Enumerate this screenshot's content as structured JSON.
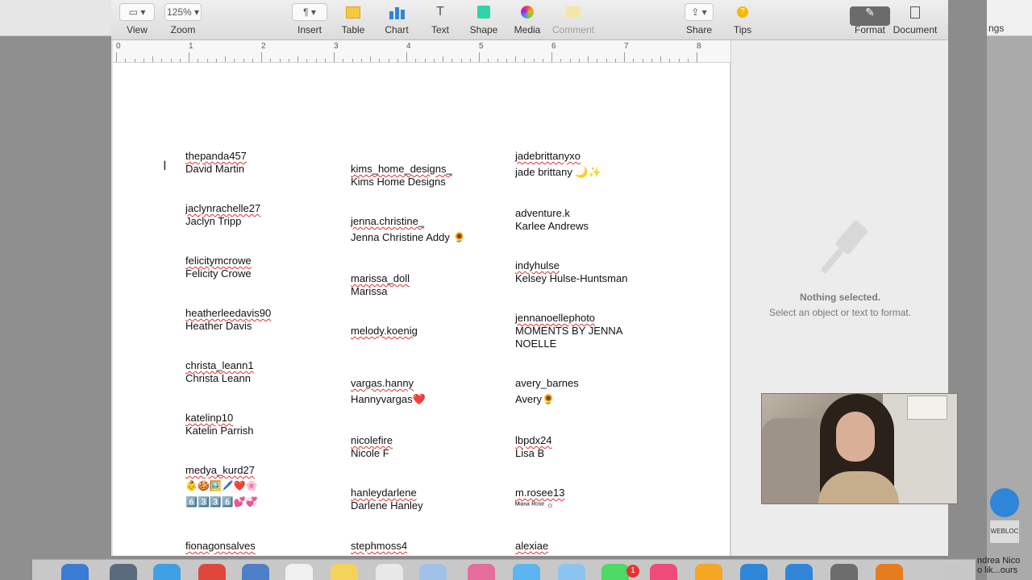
{
  "toolbar": {
    "view": "View",
    "zoom": "Zoom",
    "zoom_value": "125%",
    "insert": "Insert",
    "table": "Table",
    "chart": "Chart",
    "text": "Text",
    "shape": "Shape",
    "media": "Media",
    "comment": "Comment",
    "share": "Share",
    "tips": "Tips",
    "format": "Format",
    "document": "Document"
  },
  "ruler": [
    "0",
    "1",
    "2",
    "3",
    "4",
    "5",
    "6",
    "7",
    "8"
  ],
  "inspector": {
    "title": "Nothing selected.",
    "subtitle": "Select an object or text to format."
  },
  "columns": {
    "col1": [
      {
        "handle": "thepanda457",
        "name": "David Martin"
      },
      {
        "handle": "jaclynrachelle27",
        "name": "Jaclyn Tripp"
      },
      {
        "handle": "felicitymcrowe",
        "name": "Felicity Crowe"
      },
      {
        "handle": "heatherleedavis90",
        "name": "Heather Davis"
      },
      {
        "handle": "christa_leann1",
        "name": "Christa Leann"
      },
      {
        "handle": "katelinp10",
        "name": "Katelin Parrish"
      },
      {
        "handle": "medya_kurd27",
        "name": "👶🍪🖼️🖊️❤️🌸",
        "name2": "6️⃣3️⃣3️⃣6️⃣💕💞"
      },
      {
        "handle": "fionagonsalves",
        "name": ""
      }
    ],
    "col2": [
      {
        "handle": "kims_home_designs_",
        "name": "Kims Home Designs"
      },
      {
        "handle": "jenna.christine_",
        "name": "Jenna Christine Addy 🌻"
      },
      {
        "handle": "marissa_doll",
        "name": "Marissa"
      },
      {
        "handle": "melody.koenig",
        "name": ""
      },
      {
        "handle": "vargas.hanny",
        "name": "Hannyvargas❤️"
      },
      {
        "handle": "nicolefire",
        "name": "Nicole F"
      },
      {
        "handle": "hanleydarlene",
        "name": "Darlene Hanley"
      },
      {
        "handle": "stephmoss4",
        "name": ""
      }
    ],
    "col3": [
      {
        "handle": "jadebrittanyxo",
        "name": "jade brittany 🌙✨"
      },
      {
        "handle": "adventure.k",
        "name": "Karlee Andrews"
      },
      {
        "handle": "indyhulse",
        "name": "Kelsey Hulse-Huntsman"
      },
      {
        "handle": "jennanoellephoto",
        "name": "MOMENTS BY JENNA",
        "name2": "NOELLE"
      },
      {
        "handle": "avery_barnes",
        "name": "Avery🌻"
      },
      {
        "handle": "lbpdx24",
        "name": "Lisa B"
      },
      {
        "handle": "m.rosee13",
        "name": "ᴹᶦᵃⁿᵃ ᴿᵒˢᵉ ☼"
      },
      {
        "handle": "alexiae",
        "name": ""
      }
    ]
  },
  "desktop": {
    "right_text": "ngs",
    "right_bottom": "ndrea Nico\no lik...ours",
    "webloc": "WEBLOC",
    "dock_badge": "1"
  }
}
